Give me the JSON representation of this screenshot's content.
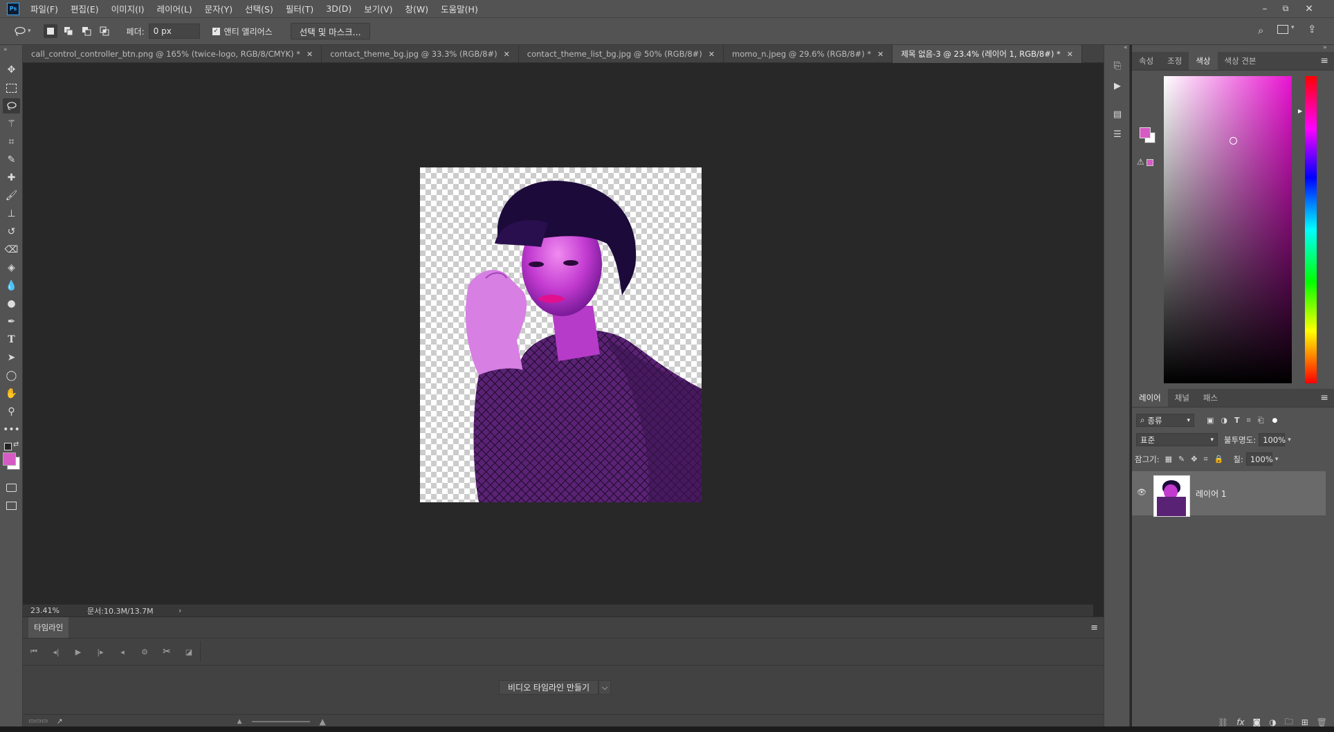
{
  "app": {
    "logo": "Ps"
  },
  "menu": [
    "파일(F)",
    "편집(E)",
    "이미지(I)",
    "레이어(L)",
    "문자(Y)",
    "선택(S)",
    "필터(T)",
    "3D(D)",
    "보기(V)",
    "창(W)",
    "도움말(H)"
  ],
  "window_controls": {
    "minimize": "–",
    "restore": "⧉",
    "close": "✕"
  },
  "options": {
    "feather_label": "페더:",
    "feather_value": "0 px",
    "antialias_label": "앤티 앨리어스",
    "antialias_checked": true,
    "select_mask_button": "선택 및 마스크..."
  },
  "tabs": [
    {
      "label": "call_control_controller_btn.png @ 165% (twice-logo, RGB/8/CMYK) *"
    },
    {
      "label": "contact_theme_bg.jpg @ 33.3% (RGB/8#)"
    },
    {
      "label": "contact_theme_list_bg.jpg @ 50% (RGB/8#)"
    },
    {
      "label": "momo_n.jpeg @ 29.6% (RGB/8#) *"
    },
    {
      "label": "제목 없음-3 @ 23.4% (레이어 1, RGB/8#) *",
      "active": true
    }
  ],
  "tab_close": "✕",
  "status": {
    "zoom": "23.41%",
    "doc": "문서:10.3M/13.7M",
    "arrow": "›"
  },
  "timeline": {
    "title": "타임라인",
    "create_button": "비디오 타임라인 만들기",
    "dropdown_arrow": "⌵"
  },
  "color_panel": {
    "tabs": [
      "속성",
      "조정",
      "색상",
      "색상 견본"
    ],
    "active_tab": "색상",
    "foreground": "#d65bc4",
    "background": "#ffffff",
    "picker_hue": "#e813d1"
  },
  "layers_panel": {
    "tabs": [
      "레이어",
      "채널",
      "패스"
    ],
    "active_tab": "레이어",
    "filter_label": "종류",
    "blend_mode": "표준",
    "opacity_label": "불투명도:",
    "opacity_value": "100%",
    "lock_label": "잠그기:",
    "fill_label": "칠:",
    "fill_value": "100%",
    "layers": [
      {
        "name": "레이어 1",
        "visible": true
      }
    ]
  },
  "colors": {
    "ui_bg": "#535353",
    "canvas_bg": "#282828",
    "accent": "#31a8ff",
    "fg_swatch": "#d65bc4"
  }
}
